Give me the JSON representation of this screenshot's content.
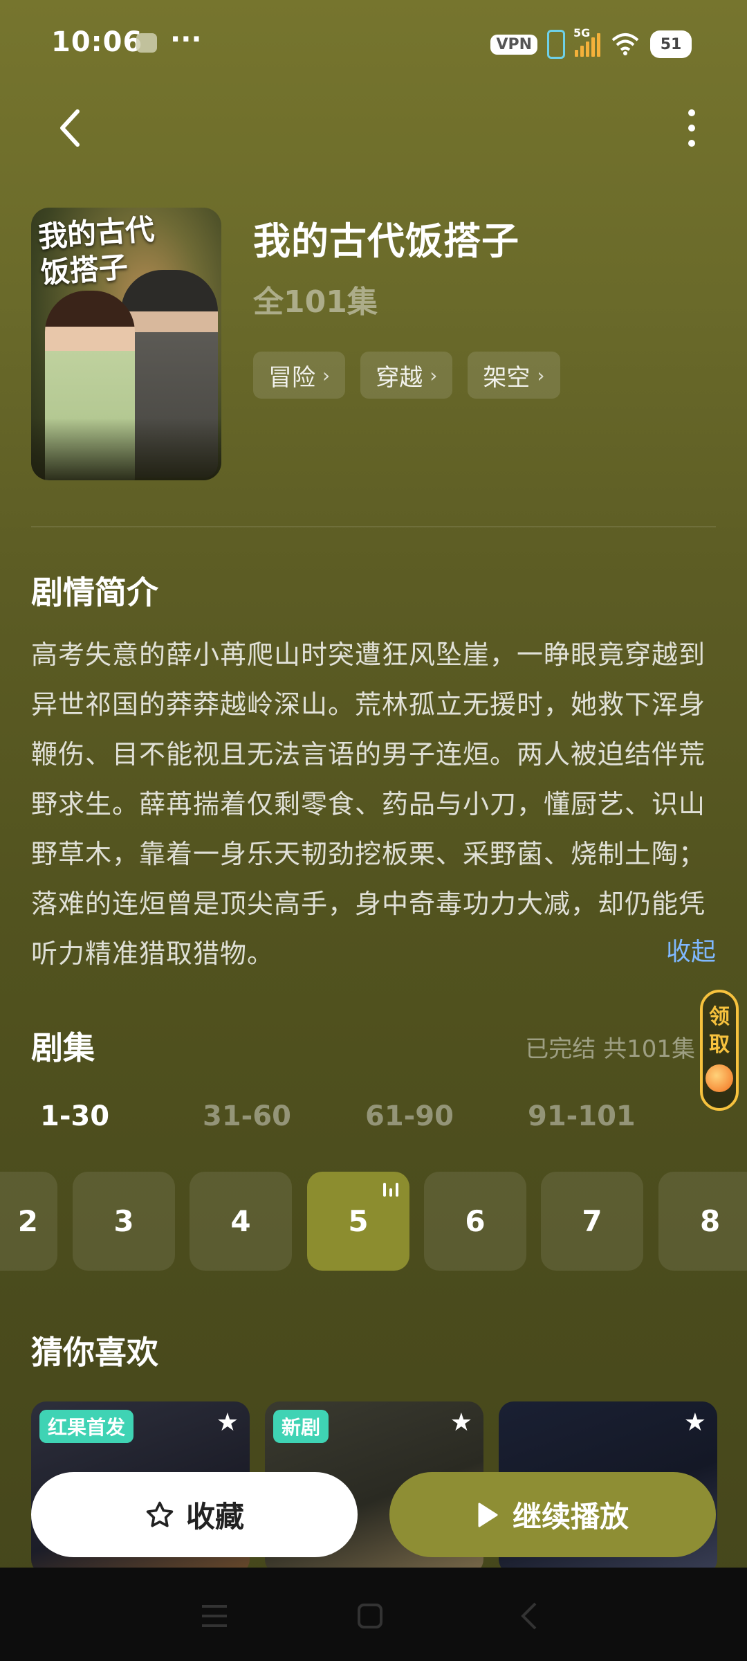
{
  "status_bar": {
    "time": "10:06",
    "dots": "···",
    "vpn": "VPN",
    "network": "5G",
    "wifi_sub": "6",
    "battery": "51"
  },
  "drama": {
    "poster_title": "我的古代饭搭子",
    "title": "我的古代饭搭子",
    "episode_total": "全101集",
    "tags": [
      {
        "label": "冒险"
      },
      {
        "label": "穿越"
      },
      {
        "label": "架空"
      }
    ]
  },
  "synopsis": {
    "heading": "剧情简介",
    "text": "高考失意的薛小苒爬山时突遭狂风坠崖，一睁眼竟穿越到异世祁国的莽莽越岭深山。荒林孤立无援时，她救下浑身鞭伤、目不能视且无法言语的男子连烜。两人被迫结伴荒野求生。薛苒揣着仅剩零食、药品与小刀，懂厨艺、识山野草木，靠着一身乐天韧劲挖板栗、采野菌、烧制土陶；落难的连烜曾是顶尖高手，身中奇毒功力大减，却仍能凭听力精准猎取猎物。",
    "collapse_label": "收起"
  },
  "episodes": {
    "heading": "剧集",
    "status": "已完结 共101集",
    "claim_label_1": "领",
    "claim_label_2": "取",
    "ranges": [
      {
        "label": "1-30",
        "active": true
      },
      {
        "label": "31-60",
        "active": false
      },
      {
        "label": "61-90",
        "active": false
      },
      {
        "label": "91-101",
        "active": false
      }
    ],
    "items": [
      {
        "label": "2"
      },
      {
        "label": "3"
      },
      {
        "label": "4"
      },
      {
        "label": "5",
        "active": true
      },
      {
        "label": "6"
      },
      {
        "label": "7"
      },
      {
        "label": "8"
      }
    ]
  },
  "recommend": {
    "heading": "猜你喜欢",
    "items": [
      {
        "badge": "红果首发"
      },
      {
        "badge": "新剧"
      },
      {
        "badge": ""
      }
    ]
  },
  "actions": {
    "favorite_label": "收藏",
    "play_label": "继续播放"
  },
  "colors": {
    "accent": "#8e8e34",
    "link": "#7fb8ff",
    "badge": "#3fd3b4",
    "claim": "#f7c23e"
  }
}
